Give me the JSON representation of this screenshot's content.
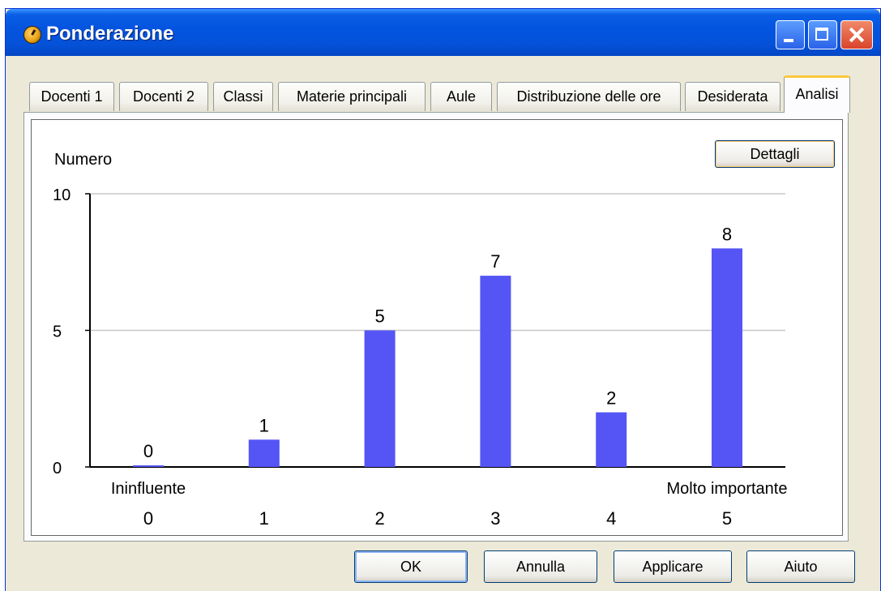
{
  "window": {
    "title": "Ponderazione"
  },
  "tabs": [
    {
      "label": "Docenti 1"
    },
    {
      "label": "Docenti 2"
    },
    {
      "label": "Classi"
    },
    {
      "label": "Materie principali"
    },
    {
      "label": "Aule"
    },
    {
      "label": "Distribuzione delle ore"
    },
    {
      "label": "Desiderata"
    },
    {
      "label": "Analisi",
      "active": true
    }
  ],
  "panel": {
    "details_button": "Dettagli"
  },
  "chart_data": {
    "type": "bar",
    "ylabel": "Numero",
    "categories": [
      "0",
      "1",
      "2",
      "3",
      "4",
      "5"
    ],
    "values": [
      0,
      1,
      5,
      7,
      2,
      8
    ],
    "data_labels": [
      "0",
      "1",
      "5",
      "7",
      "2",
      "8"
    ],
    "ylim": [
      0,
      10
    ],
    "yticks": [
      0,
      5,
      10
    ],
    "x_end_labels": {
      "left": "Ininfluente",
      "right": "Molto importante"
    },
    "grid": true,
    "bar_color": "#5555f5"
  },
  "buttons": {
    "ok": "OK",
    "cancel": "Annulla",
    "apply": "Applicare",
    "help": "Aiuto"
  }
}
